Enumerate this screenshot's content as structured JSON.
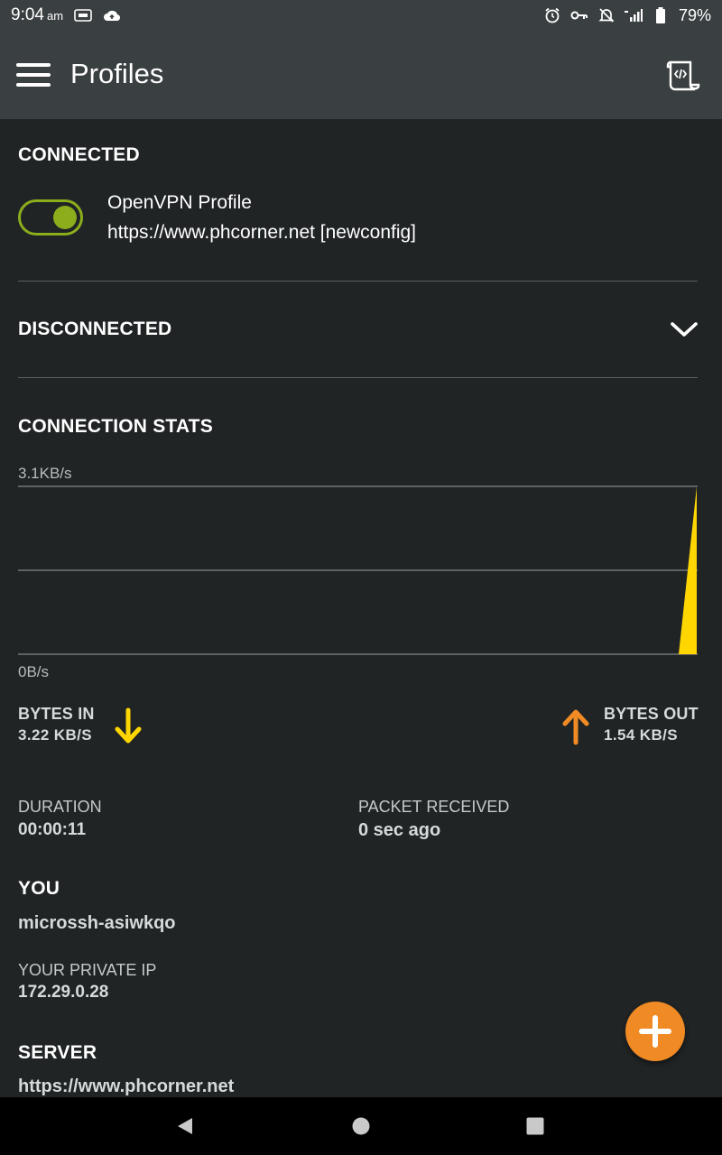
{
  "status_bar": {
    "time": "9:04",
    "ampm": "am",
    "battery": "79%"
  },
  "app_bar": {
    "title": "Profiles"
  },
  "connected": {
    "heading": "CONNECTED",
    "toggle_on": true,
    "profile_name": "OpenVPN Profile",
    "profile_url": "https://www.phcorner.net [newconfig]"
  },
  "disconnected": {
    "heading": "DISCONNECTED"
  },
  "stats": {
    "heading": "CONNECTION STATS",
    "chart_data": {
      "type": "area",
      "ylabel_top": "3.1KB/s",
      "ylabel_bottom": "0B/s",
      "ylim": [
        0,
        3.1
      ],
      "unit": "KB/s",
      "x": [
        0,
        1,
        2,
        3,
        4,
        5,
        6,
        7,
        8,
        9,
        10,
        11
      ],
      "series": [
        {
          "values": [
            0,
            0,
            0,
            0,
            0,
            0,
            0,
            0,
            0,
            0,
            0,
            3.1
          ]
        }
      ],
      "grid": true,
      "color": "#ffd600"
    },
    "bytes_in_label": "BYTES IN",
    "bytes_in_value": "3.22 KB/S",
    "bytes_out_label": "BYTES OUT",
    "bytes_out_value": "1.54 KB/S",
    "colors": {
      "in": "#ffd600",
      "out": "#f08a24"
    }
  },
  "details": {
    "duration_label": "DURATION",
    "duration_value": "00:00:11",
    "packet_label": "PACKET RECEIVED",
    "packet_value": "0 sec ago",
    "you_heading": "YOU",
    "you_value": "microssh-asiwkqo",
    "private_ip_label": "YOUR PRIVATE IP",
    "private_ip_value": "172.29.0.28",
    "server_heading": "SERVER",
    "server_value": "https://www.phcorner.net"
  },
  "icons": {
    "menu": "hamburger-menu-icon",
    "log": "log-file-icon",
    "expand": "chevron-down-icon",
    "arrow_in": "arrow-down-icon",
    "arrow_out": "arrow-up-icon",
    "add": "plus-icon"
  },
  "accent": "#8cad1c",
  "fab_color": "#f08a24"
}
